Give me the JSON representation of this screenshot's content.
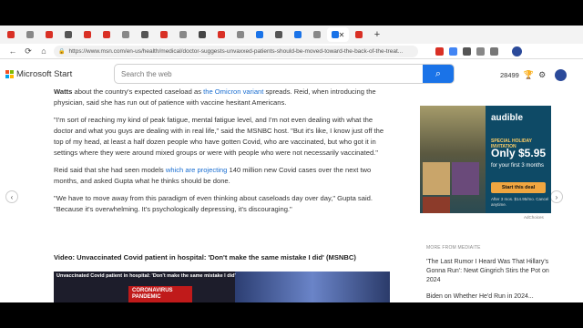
{
  "browser": {
    "tabs": [
      {
        "color": "#d93025"
      },
      {
        "color": "#888888"
      },
      {
        "color": "#d93025"
      },
      {
        "color": "#555555"
      },
      {
        "color": "#d93025"
      },
      {
        "color": "#d93025"
      },
      {
        "color": "#888888"
      },
      {
        "color": "#555555"
      },
      {
        "color": "#d93025"
      },
      {
        "color": "#888888"
      },
      {
        "color": "#444444"
      },
      {
        "color": "#d93025"
      },
      {
        "color": "#888888"
      },
      {
        "color": "#1a73e8"
      },
      {
        "color": "#555555"
      },
      {
        "color": "#1a73e8"
      },
      {
        "color": "#888888"
      },
      {
        "color": "#1a73e8"
      },
      {
        "color": "#d93025"
      }
    ],
    "active_tab_close": "✕",
    "new_tab": "+",
    "url": "https://www.msn.com/en-us/health/medical/doctor-suggests-unvaxxed-patients-should-be-moved-toward-the-back-of-the-treat..."
  },
  "msn": {
    "logo_text": "Microsoft Start",
    "search_placeholder": "Search the web",
    "rewards_points": "28499"
  },
  "article": {
    "p1_lead": "Watts",
    "p1_a": " about the country's expected caseload as ",
    "p1_link": "the Omicron variant",
    "p1_b": " spreads. Reid, when introducing the physician, said she has run out of patience with vaccine hesitant Americans.",
    "p2": "\"I'm sort of reaching my kind of peak fatigue, mental fatigue level, and I'm not even dealing with what the doctor and what you guys are dealing with in real life,\" said the MSNBC host. \"But it's like, I know just off the top of my head, at least a half dozen people who have gotten Covid, who are vaccinated, but who got it in settings where they were around mixed groups or were with people who were not necessarily vaccinated.\"",
    "p3_a": "Reid said that she had seen models ",
    "p3_link": "which are projecting",
    "p3_b": " 140 million new Covid cases over the next two months, and asked Gupta what he thinks should be done.",
    "p4": "\"We have to move away from this paradigm of even thinking about caseloads day over day,\" Gupta said. \"Because it's overwhelming. It's psychologically depressing, it's discouraging.\"",
    "video_title": "Video: Unvaccinated Covid patient in hospital: 'Don't make the same mistake I did' (MSNBC)",
    "video_caption": "Unvaccinated Covid patient in hospital: 'Don't make the same mistake I did'",
    "video_banner": "CORONAVIRUS PANDEMIC"
  },
  "ad": {
    "brand": "audible",
    "invite": "SPECIAL HOLIDAY INVITATION",
    "price": "Only $5.95",
    "months": "for your first 3 months",
    "cta": "Start this deal",
    "fine_print": "After 3 mos. $14.95/mo. Cancel anytime.",
    "adchoices": "AdChoices"
  },
  "sidebar": {
    "more_from": "MORE FROM Mediaite",
    "items": [
      "'The Last Rumor I Heard Was That Hillary's Gonna Run': Newt Gingrich Stirs the Pot on 2024",
      "Biden on Whether He'd Run in 2024..."
    ]
  }
}
